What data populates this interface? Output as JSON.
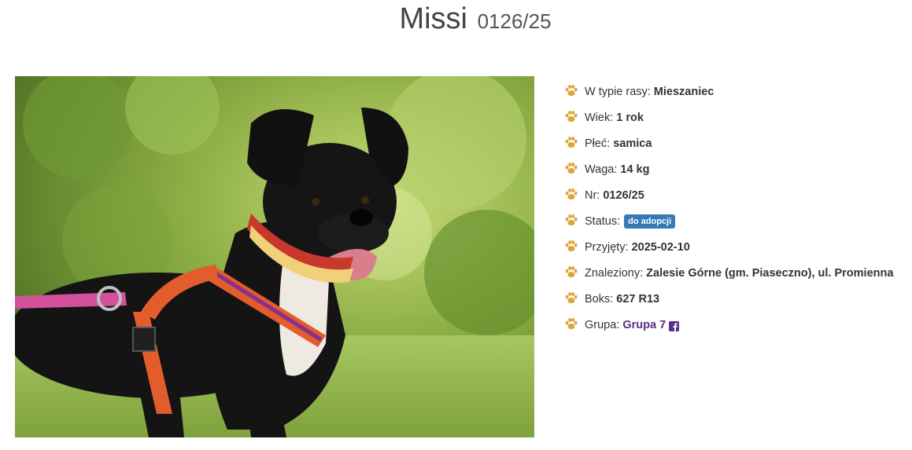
{
  "header": {
    "name": "Missi",
    "number": "0126/25"
  },
  "photo": {
    "alt": "Missi"
  },
  "details": {
    "breed": {
      "label": "W typie rasy:",
      "value": "Mieszaniec"
    },
    "age": {
      "label": "Wiek:",
      "value": "1 rok"
    },
    "sex": {
      "label": "Płeć:",
      "value": "samica"
    },
    "weight": {
      "label": "Waga:",
      "value": "14 kg"
    },
    "nr": {
      "label": "Nr:",
      "value": "0126/25"
    },
    "status": {
      "label": "Status:",
      "value": "do adopcji"
    },
    "admitted": {
      "label": "Przyjęty:",
      "value": "2025-02-10"
    },
    "found": {
      "label": "Znaleziony:",
      "value": "Zalesie Górne (gm. Piaseczno), ul. Promienna"
    },
    "box": {
      "label": "Boks:",
      "value": "627 R13"
    },
    "group": {
      "label": "Grupa:",
      "value": "Grupa 7"
    }
  },
  "icons": {
    "bullet": "paw-icon",
    "group_link": "facebook-icon"
  },
  "colors": {
    "paw": "#e0a53a",
    "status_badge": "#337ab7",
    "group_link": "#5b2c83"
  }
}
